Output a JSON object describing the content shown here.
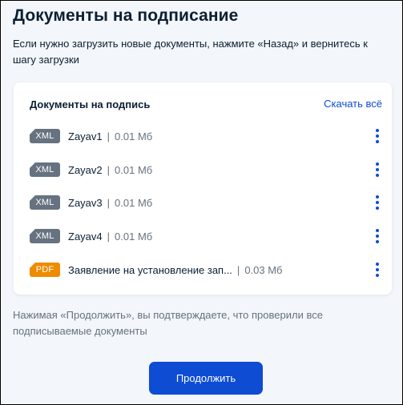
{
  "page": {
    "title": "Документы на подписание",
    "subtitle": "Если нужно загрузить новые документы, нажмите «Назад» и вернитесь к шагу загрузки"
  },
  "card": {
    "title": "Документы на подпись",
    "download_all_label": "Скачать всё",
    "files": [
      {
        "type": "XML",
        "name": "Zayav1",
        "separator": "|",
        "size": "0.01 Мб"
      },
      {
        "type": "XML",
        "name": "Zayav2",
        "separator": "|",
        "size": "0.01 Мб"
      },
      {
        "type": "XML",
        "name": "Zayav3",
        "separator": "|",
        "size": "0.01 Мб"
      },
      {
        "type": "XML",
        "name": "Zayav4",
        "separator": "|",
        "size": "0.01 Мб"
      },
      {
        "type": "PDF",
        "name": "Заявление на установление зап...",
        "separator": "|",
        "size": "0.03 Мб"
      }
    ]
  },
  "notice": "Нажимая «Продолжить», вы подтверждаете, что проверили все подписываемые документы",
  "actions": {
    "continue_label": "Продолжить"
  },
  "icons": {
    "file_menu": "more-vertical-icon"
  },
  "colors": {
    "primary": "#0d4cd3",
    "xml_badge": "#66727f",
    "pdf_badge": "#ee8b00",
    "background": "#f3f6fa",
    "text": "#0b1f33",
    "secondary_text": "#66727f"
  }
}
